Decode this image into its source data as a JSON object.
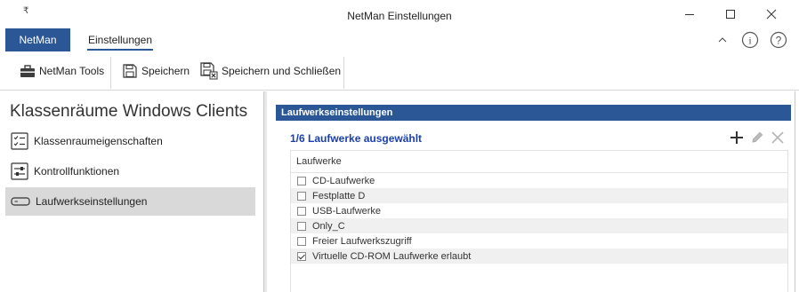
{
  "window": {
    "title": "NetMan Einstellungen",
    "quick_access": "₹",
    "accent": "#2b5797"
  },
  "ribbon": {
    "tabs": [
      {
        "label": "NetMan",
        "active": false
      },
      {
        "label": "Einstellungen",
        "active": true
      }
    ],
    "toolbar": {
      "netman_tools": "NetMan Tools",
      "save": "Speichern",
      "save_close": "Speichern und Schließen"
    }
  },
  "left": {
    "title": "Klassenräume Windows Clients",
    "items": [
      {
        "label": "Klassenraumeigenschaften",
        "icon": "checklist-icon",
        "active": false
      },
      {
        "label": "Kontrollfunktionen",
        "icon": "sliders-icon",
        "active": false
      },
      {
        "label": "Laufwerkseinstellungen",
        "icon": "drive-icon",
        "active": true
      }
    ]
  },
  "right": {
    "header": "Laufwerkseinstellungen",
    "selection_status": "1/6 Laufwerke ausgewählt",
    "column_header": "Laufwerke",
    "rows": [
      {
        "label": "CD-Laufwerke",
        "checked": false
      },
      {
        "label": "Festplatte D",
        "checked": false
      },
      {
        "label": "USB-Laufwerke",
        "checked": false
      },
      {
        "label": "Only_C",
        "checked": false
      },
      {
        "label": "Freier Laufwerkszugriff",
        "checked": false
      },
      {
        "label": "Virtuelle CD-ROM Laufwerke erlaubt",
        "checked": true
      }
    ]
  }
}
